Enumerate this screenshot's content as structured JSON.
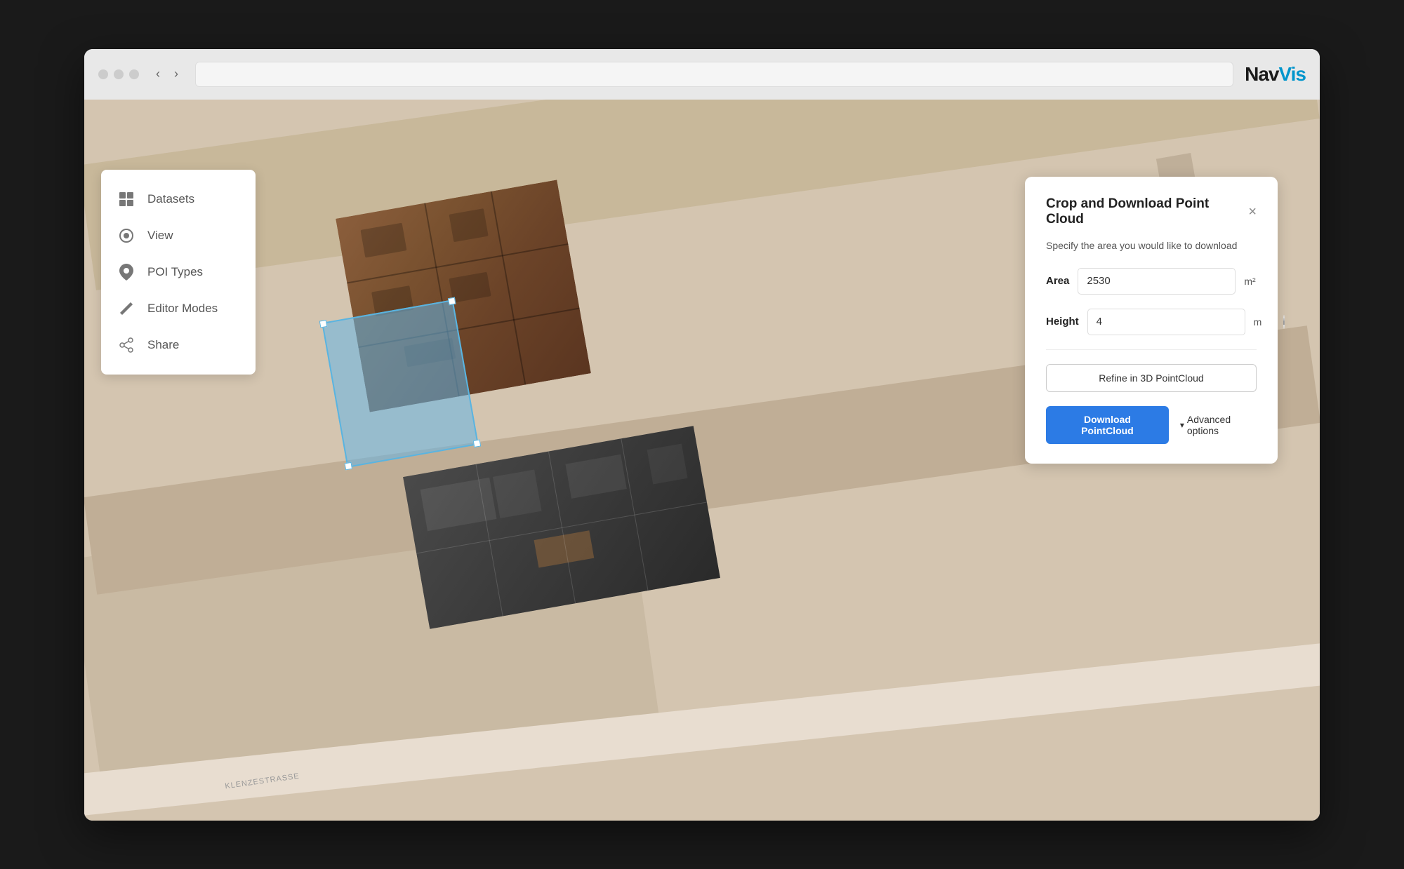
{
  "browser": {
    "logo_nav": "Nav",
    "logo_vis": "Vis"
  },
  "sidebar": {
    "items": [
      {
        "id": "datasets",
        "label": "Datasets",
        "icon": "⊞"
      },
      {
        "id": "view",
        "label": "View",
        "icon": "👁"
      },
      {
        "id": "poi-types",
        "label": "POI Types",
        "icon": "📍"
      },
      {
        "id": "editor-modes",
        "label": "Editor Modes",
        "icon": "✏"
      },
      {
        "id": "share",
        "label": "Share",
        "icon": "⤢"
      }
    ]
  },
  "panel": {
    "title": "Crop and Download Point Cloud",
    "subtitle": "Specify the area you would like to download",
    "area_label": "Area",
    "area_value": "2530",
    "area_unit": "m²",
    "height_label": "Height",
    "height_value": "4",
    "height_unit": "m",
    "refine_button": "Refine in 3D PointCloud",
    "download_button": "Download PointCloud",
    "advanced_options": "Advanced options",
    "close_button": "×"
  },
  "map": {
    "street_label": "KLENZESTRASSE"
  }
}
